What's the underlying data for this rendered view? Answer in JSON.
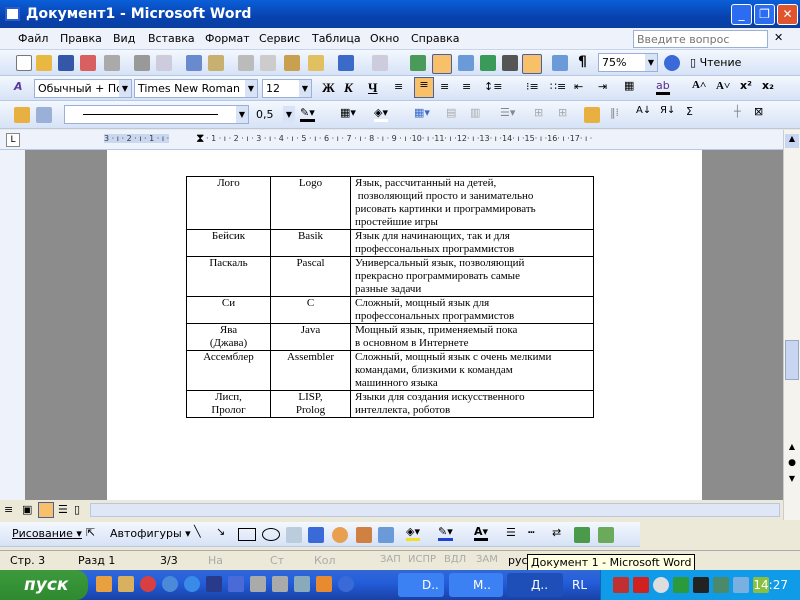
{
  "window": {
    "title": "Документ1 - Microsoft Word"
  },
  "menu": [
    "Файл",
    "Правка",
    "Вид",
    "Вставка",
    "Формат",
    "Сервис",
    "Таблица",
    "Окно",
    "Справка"
  ],
  "help_box": {
    "placeholder": "Введите вопрос"
  },
  "standard_toolbar": {
    "zoom": "75%",
    "reading_label": "Чтение"
  },
  "formatting_toolbar": {
    "style": "Обычный + По ц",
    "font": "Times New Roman",
    "size": "12",
    "bold": "Ж",
    "italic": "К",
    "underline": "Ч"
  },
  "tables_toolbar": {
    "line_weight": "0,5"
  },
  "ruler": {
    "left_ticks": "3 · ı · 2 · ı · 1 · ı ·",
    "right_ticks": "· 1 · ı · 2 · ı · 3 · ı · 4 · ı · 5 · ı · 6 · ı · 7 · ı · 8 · ı · 9 · ı ·10· ı ·11· ı ·12· ı ·13· ı ·14· ı ·15· ı ·16· ı ·17· ı ·"
  },
  "table": {
    "rows": [
      [
        "Лого",
        "Logo",
        "Язык, рассчитанный на детей,\n позволяющий просто и занимательно\nрисовать картинки и программировать\nпростейшие игры"
      ],
      [
        "Бейсик",
        "Basik",
        "Язык для начинающих, так и для\nпрофессональных программистов"
      ],
      [
        "Паскаль",
        "Pascal",
        "Универсальный язык, позволяющий\nпрекрасно программировать самые\nразные задачи"
      ],
      [
        "Си",
        "C",
        "Сложный, мощный язык для\nпрофессональных программистов"
      ],
      [
        "Ява\n(Джава)",
        "Java",
        "Мощный язык, применяемый пока\nв основном в Интернете"
      ],
      [
        "Ассемблер",
        "Assembler",
        "Сложный, мощный язык с очень мелкими\nкомандами, близкими к командам\nмашинного языка"
      ],
      [
        "Лисп,\nПролог",
        "LISP,\nProlog",
        "Языки для создания искусственного\nинтеллекта, роботов"
      ]
    ]
  },
  "drawing_toolbar": {
    "drawing": "Рисование",
    "autoshapes": "Автофигуры"
  },
  "status": {
    "page": "Стр.  3",
    "section": "Разд  1",
    "pages": "3/3",
    "at": "На",
    "line": "Ст",
    "col": "Кол",
    "rec": "ЗАП",
    "trk": "ИСПР",
    "ext": "ВДЛ",
    "ovr": "ЗАМ",
    "lang": "рус"
  },
  "tooltip": "Документ 1 - Microsoft Word",
  "taskbar": {
    "start": "пуск",
    "tasks": [
      "D..",
      "M..",
      "Д.."
    ],
    "lang": "RL",
    "clock": "14:27"
  }
}
